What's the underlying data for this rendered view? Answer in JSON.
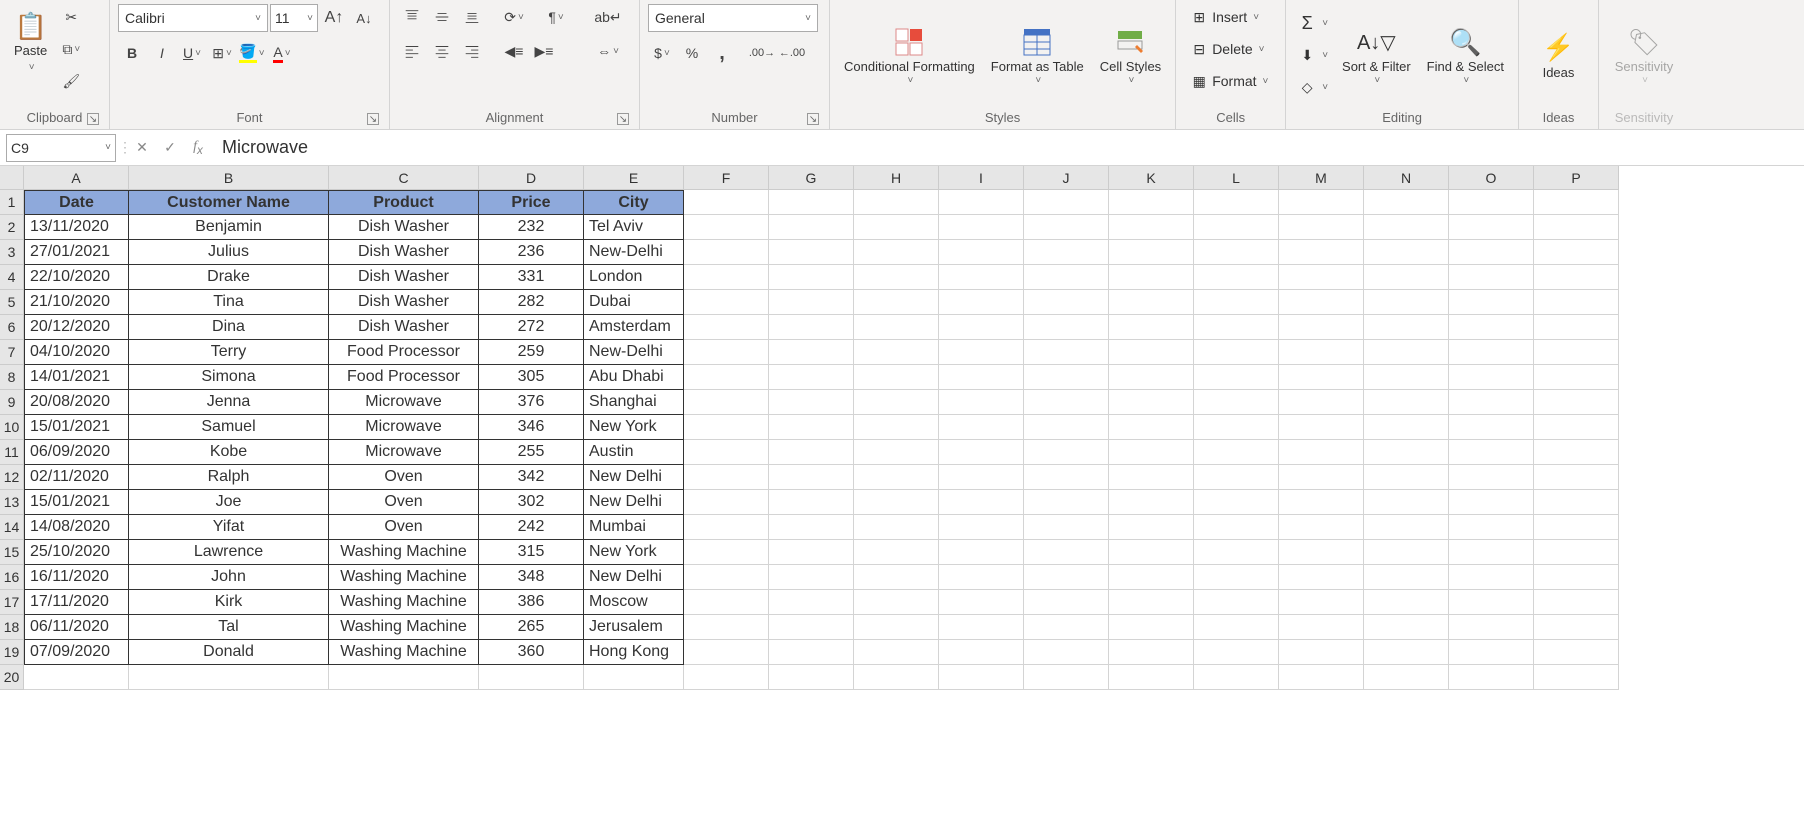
{
  "ribbon": {
    "clipboard": {
      "label": "Clipboard",
      "paste": "Paste"
    },
    "font": {
      "label": "Font",
      "name": "Calibri",
      "size": "11"
    },
    "alignment": {
      "label": "Alignment"
    },
    "number": {
      "label": "Number",
      "format": "General"
    },
    "styles": {
      "label": "Styles",
      "cond": "Conditional Formatting",
      "fat": "Format as Table",
      "cs": "Cell Styles"
    },
    "cells": {
      "label": "Cells",
      "insert": "Insert",
      "delete": "Delete",
      "format": "Format"
    },
    "editing": {
      "label": "Editing",
      "sort": "Sort & Filter",
      "find": "Find & Select"
    },
    "ideas": {
      "label": "Ideas",
      "btn": "Ideas"
    },
    "sensitivity": {
      "label": "Sensitivity",
      "btn": "Sensitivity"
    }
  },
  "formula_bar": {
    "cell_ref": "C9",
    "value": "Microwave"
  },
  "columns": [
    "A",
    "B",
    "C",
    "D",
    "E",
    "F",
    "G",
    "H",
    "I",
    "J",
    "K",
    "L",
    "M",
    "N",
    "O",
    "P"
  ],
  "headers": [
    "Date",
    "Customer Name",
    "Product",
    "Price",
    "City"
  ],
  "rows": [
    {
      "n": 1
    },
    {
      "n": 2,
      "d": [
        "13/11/2020",
        "Benjamin",
        "Dish Washer",
        "232",
        "Tel Aviv"
      ]
    },
    {
      "n": 3,
      "d": [
        "27/01/2021",
        "Julius",
        "Dish Washer",
        "236",
        "New-Delhi"
      ]
    },
    {
      "n": 4,
      "d": [
        "22/10/2020",
        "Drake",
        "Dish Washer",
        "331",
        "London"
      ]
    },
    {
      "n": 5,
      "d": [
        "21/10/2020",
        "Tina",
        "Dish Washer",
        "282",
        "Dubai"
      ]
    },
    {
      "n": 6,
      "d": [
        "20/12/2020",
        "Dina",
        "Dish Washer",
        "272",
        "Amsterdam"
      ]
    },
    {
      "n": 7,
      "d": [
        "04/10/2020",
        "Terry",
        "Food Processor",
        "259",
        "New-Delhi"
      ]
    },
    {
      "n": 8,
      "d": [
        "14/01/2021",
        "Simona",
        "Food Processor",
        "305",
        "Abu Dhabi"
      ]
    },
    {
      "n": 9,
      "d": [
        "20/08/2020",
        "Jenna",
        "Microwave",
        "376",
        "Shanghai"
      ]
    },
    {
      "n": 10,
      "d": [
        "15/01/2021",
        "Samuel",
        "Microwave",
        "346",
        "New York"
      ]
    },
    {
      "n": 11,
      "d": [
        "06/09/2020",
        "Kobe",
        "Microwave",
        "255",
        "Austin"
      ]
    },
    {
      "n": 12,
      "d": [
        "02/11/2020",
        "Ralph",
        "Oven",
        "342",
        "New Delhi"
      ]
    },
    {
      "n": 13,
      "d": [
        "15/01/2021",
        "Joe",
        "Oven",
        "302",
        "New Delhi"
      ]
    },
    {
      "n": 14,
      "d": [
        "14/08/2020",
        "Yifat",
        "Oven",
        "242",
        "Mumbai"
      ]
    },
    {
      "n": 15,
      "d": [
        "25/10/2020",
        "Lawrence",
        "Washing Machine",
        "315",
        "New York"
      ]
    },
    {
      "n": 16,
      "d": [
        "16/11/2020",
        "John",
        "Washing Machine",
        "348",
        "New Delhi"
      ]
    },
    {
      "n": 17,
      "d": [
        "17/11/2020",
        "Kirk",
        "Washing Machine",
        "386",
        "Moscow"
      ]
    },
    {
      "n": 18,
      "d": [
        "06/11/2020",
        "Tal",
        "Washing Machine",
        "265",
        "Jerusalem"
      ]
    },
    {
      "n": 19,
      "d": [
        "07/09/2020",
        "Donald",
        "Washing Machine",
        "360",
        "Hong Kong"
      ]
    },
    {
      "n": 20
    }
  ]
}
